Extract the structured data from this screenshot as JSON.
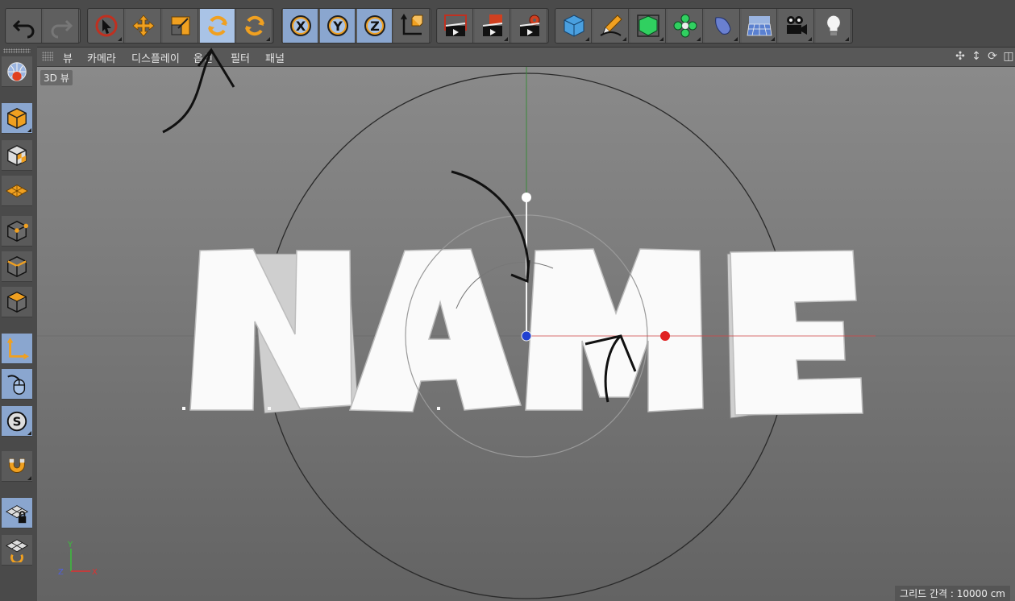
{
  "menu": {
    "items": [
      "뷰",
      "카메라",
      "디스플레이",
      "옵션",
      "필터",
      "패널"
    ]
  },
  "viewport": {
    "label": "3D 뷰",
    "grid_label": "그리드 간격 : 10000 cm",
    "scene_text": "NAME",
    "axis_x": "X",
    "axis_y": "Y",
    "axis_z": "Z"
  },
  "toolbar": {
    "axis_x": "X",
    "axis_y": "Y",
    "axis_z": "Z"
  },
  "colors": {
    "selected": "#8aa6cf",
    "accent_orange": "#f0a020",
    "x_axis": "#e03030",
    "y_axis": "#30b030",
    "z_axis": "#3050e0"
  }
}
